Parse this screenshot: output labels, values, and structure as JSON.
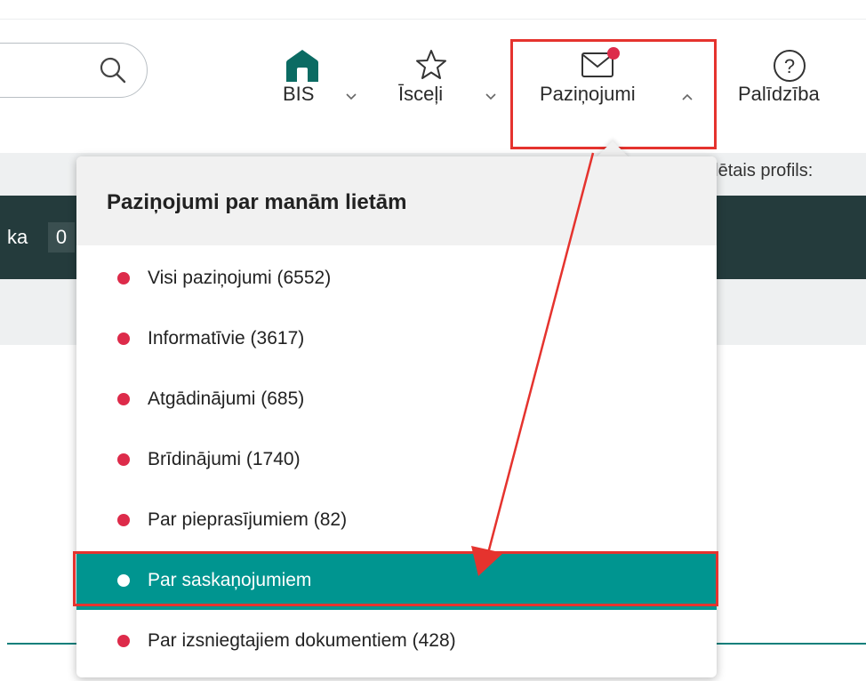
{
  "header": {
    "nav": [
      {
        "label": "BIS",
        "icon": "home-icon"
      },
      {
        "label": "Īsceļi",
        "icon": "star-icon"
      },
      {
        "label": "Paziņojumi",
        "icon": "envelope-icon",
        "has_notification": true,
        "expanded": true
      },
      {
        "label": "Palīdzība",
        "icon": "help-icon"
      }
    ]
  },
  "subbar": {
    "profile_text": "ēlētais profils:"
  },
  "darkbar": {
    "text": "ka",
    "value": "0"
  },
  "dropdown": {
    "title": "Paziņojumi par manām lietām",
    "items": [
      {
        "label": "Visi paziņojumi (6552)",
        "selected": false
      },
      {
        "label": "Informatīvie (3617)",
        "selected": false
      },
      {
        "label": "Atgādinājumi (685)",
        "selected": false
      },
      {
        "label": "Brīdinājumi (1740)",
        "selected": false
      },
      {
        "label": "Par pieprasījumiem (82)",
        "selected": false
      },
      {
        "label": "Par saskaņojumiem",
        "selected": true
      },
      {
        "label": "Par izsniegtajiem dokumentiem (428)",
        "selected": false
      }
    ]
  },
  "colors": {
    "accent_teal": "#009590",
    "dark_bar": "#243b3c",
    "notification_dot": "#dd2b4a",
    "highlight_red": "#e5332e",
    "home_icon": "#0b6b63"
  }
}
